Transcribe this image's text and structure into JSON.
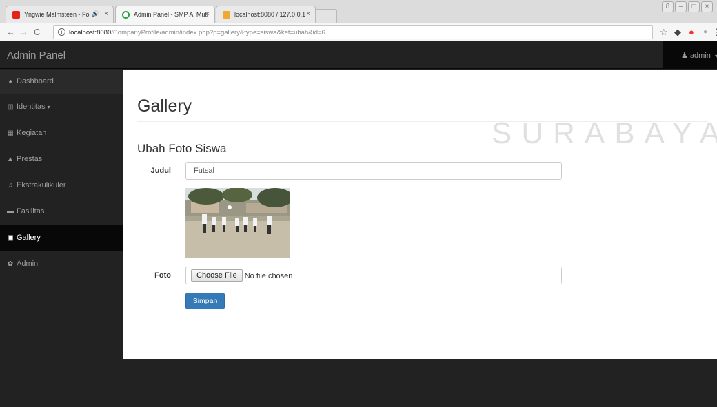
{
  "browser": {
    "tabs": [
      {
        "label": "Yngwie Malmsteen - Fo",
        "has_audio": true,
        "active": false
      },
      {
        "label": "Admin Panel - SMP Al Muti",
        "active": true
      },
      {
        "label": "localhost:8080 / 127.0.0.1",
        "active": false
      }
    ],
    "url_host": "localhost:8080",
    "url_path": "/CompanyProfile/admin/index.php?p=gallery&type=siswa&ket=ubah&id=6",
    "close_glyph": "×",
    "icons": [
      "back-icon",
      "forward-icon",
      "reload-icon",
      "info-icon",
      "star-icon",
      "extension-icon",
      "adblock-icon",
      "menu-icon"
    ]
  },
  "navbar": {
    "brand": "Admin Panel",
    "user": "admin"
  },
  "sidebar": {
    "items": [
      {
        "label": "Dashboard",
        "icon": "dashboard-icon"
      },
      {
        "label": "Identitas",
        "icon": "institution-icon",
        "has_caret": true
      },
      {
        "label": "Kegiatan",
        "icon": "calendar-icon"
      },
      {
        "label": "Prestasi",
        "icon": "thumbs-up-icon"
      },
      {
        "label": "Ekstrakulikuler",
        "icon": "music-icon"
      },
      {
        "label": "Fasilitas",
        "icon": "bed-icon"
      },
      {
        "label": "Gallery",
        "icon": "image-icon",
        "active": true
      },
      {
        "label": "Admin",
        "icon": "gear-icon"
      }
    ]
  },
  "main": {
    "title": "Gallery",
    "subtitle": "Ubah Foto Siswa",
    "form": {
      "judul_label": "Judul",
      "judul_value": "Futsal",
      "foto_label": "Foto",
      "file_button": "Choose File",
      "file_status": "No file chosen",
      "submit_label": "Simpan"
    }
  },
  "watermark": "SURABAYA",
  "colors": {
    "navbar_bg": "#222222",
    "sidebar_active": "#080808",
    "primary_button": "#337ab7"
  }
}
